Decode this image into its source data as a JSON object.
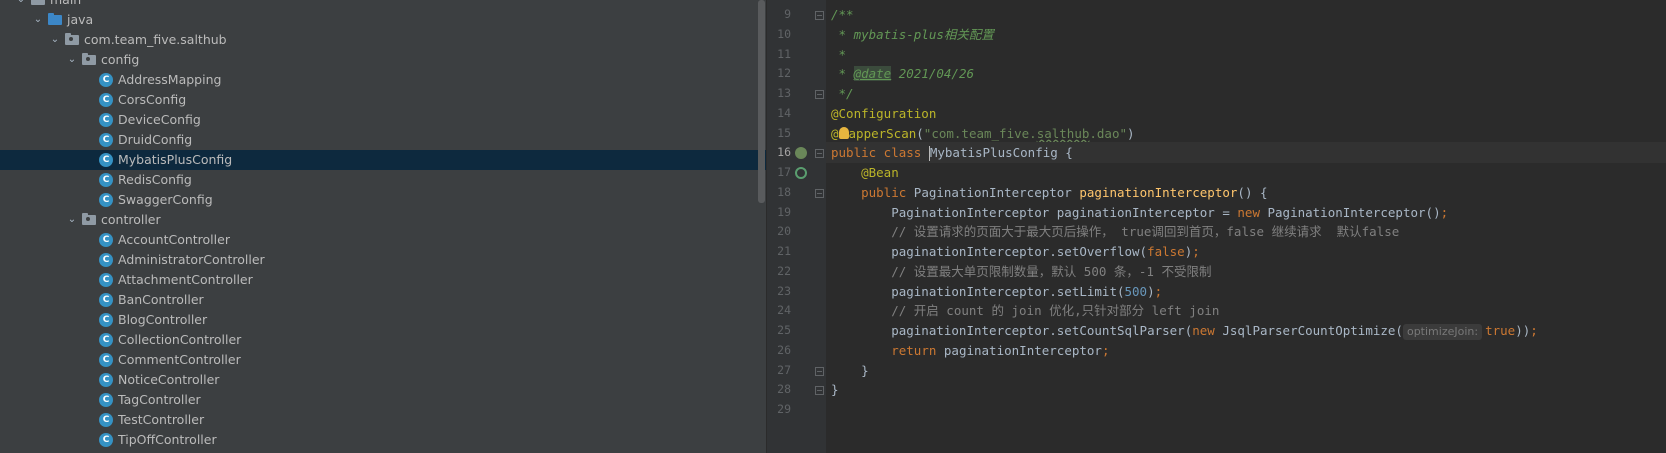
{
  "project_tree": {
    "rows": [
      {
        "label": "main",
        "indent": 1,
        "kind": "folder"
      },
      {
        "label": "java",
        "indent": 2,
        "kind": "src-folder"
      },
      {
        "label": "com.team_five.salthub",
        "indent": 3,
        "kind": "package"
      },
      {
        "label": "config",
        "indent": 4,
        "kind": "package"
      },
      {
        "label": "AddressMapping",
        "indent": 5,
        "kind": "class"
      },
      {
        "label": "CorsConfig",
        "indent": 5,
        "kind": "class"
      },
      {
        "label": "DeviceConfig",
        "indent": 5,
        "kind": "class"
      },
      {
        "label": "DruidConfig",
        "indent": 5,
        "kind": "class"
      },
      {
        "label": "MybatisPlusConfig",
        "indent": 5,
        "kind": "class",
        "selected": true
      },
      {
        "label": "RedisConfig",
        "indent": 5,
        "kind": "class"
      },
      {
        "label": "SwaggerConfig",
        "indent": 5,
        "kind": "class"
      },
      {
        "label": "controller",
        "indent": 4,
        "kind": "package"
      },
      {
        "label": "AccountController",
        "indent": 5,
        "kind": "class"
      },
      {
        "label": "AdministratorController",
        "indent": 5,
        "kind": "class"
      },
      {
        "label": "AttachmentController",
        "indent": 5,
        "kind": "class"
      },
      {
        "label": "BanController",
        "indent": 5,
        "kind": "class"
      },
      {
        "label": "BlogController",
        "indent": 5,
        "kind": "class"
      },
      {
        "label": "CollectionController",
        "indent": 5,
        "kind": "class"
      },
      {
        "label": "CommentController",
        "indent": 5,
        "kind": "class"
      },
      {
        "label": "NoticeController",
        "indent": 5,
        "kind": "class"
      },
      {
        "label": "TagController",
        "indent": 5,
        "kind": "class"
      },
      {
        "label": "TestController",
        "indent": 5,
        "kind": "class"
      },
      {
        "label": "TipOffController",
        "indent": 5,
        "kind": "class"
      }
    ]
  },
  "editor": {
    "current_line": 16,
    "lines": [
      {
        "n": 9,
        "tokens": [
          [
            "doc",
            "/**"
          ]
        ]
      },
      {
        "n": 10,
        "tokens": [
          [
            "doc",
            " * mybatis-plus相关配置"
          ]
        ]
      },
      {
        "n": 11,
        "tokens": [
          [
            "doc",
            " *"
          ]
        ]
      },
      {
        "n": 12,
        "tokens": [
          [
            "doc",
            " * "
          ],
          [
            "doctag",
            "@date"
          ],
          [
            "doc",
            " 2021/04/26"
          ]
        ]
      },
      {
        "n": 13,
        "tokens": [
          [
            "doc",
            " */"
          ]
        ]
      },
      {
        "n": 14,
        "tokens": [
          [
            "ann",
            "@Configuration"
          ]
        ]
      },
      {
        "n": 15,
        "tokens": [
          [
            "ann",
            "@"
          ],
          [
            "bulb",
            ""
          ],
          [
            "ann",
            "apperScan"
          ],
          [
            "plain",
            "("
          ],
          [
            "str",
            "\"com.team_five."
          ],
          [
            "str-ul",
            "salthub"
          ],
          [
            "str",
            ".dao\""
          ],
          [
            "plain",
            ")"
          ]
        ]
      },
      {
        "n": 16,
        "tokens": [
          [
            "kw",
            "public class "
          ],
          [
            "caret",
            ""
          ],
          [
            "plain",
            "MybatisPlusConfig {"
          ]
        ]
      },
      {
        "n": 17,
        "tokens": [
          [
            "plain",
            "    "
          ],
          [
            "ann",
            "@Bean"
          ]
        ]
      },
      {
        "n": 18,
        "tokens": [
          [
            "plain",
            "    "
          ],
          [
            "kw",
            "public "
          ],
          [
            "plain",
            "PaginationInterceptor "
          ],
          [
            "fn",
            "paginationInterceptor"
          ],
          [
            "plain",
            "() {"
          ]
        ]
      },
      {
        "n": 19,
        "tokens": [
          [
            "plain",
            "        PaginationInterceptor paginationInterceptor = "
          ],
          [
            "kw",
            "new "
          ],
          [
            "plain",
            "PaginationInterceptor()"
          ],
          [
            "kw",
            ";"
          ]
        ]
      },
      {
        "n": 20,
        "tokens": [
          [
            "cmt",
            "        // 设置请求的页面大于最大页后操作， true调回到首页，false 继续请求  默认false"
          ]
        ]
      },
      {
        "n": 21,
        "tokens": [
          [
            "plain",
            "        paginationInterceptor.setOverflow("
          ],
          [
            "kw",
            "false"
          ],
          [
            "plain",
            ")"
          ],
          [
            "kw",
            ";"
          ]
        ]
      },
      {
        "n": 22,
        "tokens": [
          [
            "cmt",
            "        // 设置最大单页限制数量，默认 500 条，-1 不受限制"
          ]
        ]
      },
      {
        "n": 23,
        "tokens": [
          [
            "plain",
            "        paginationInterceptor.setLimit("
          ],
          [
            "num",
            "500"
          ],
          [
            "plain",
            ")"
          ],
          [
            "kw",
            ";"
          ]
        ]
      },
      {
        "n": 24,
        "tokens": [
          [
            "cmt",
            "        // 开启 count 的 join 优化,只针对部分 left join"
          ]
        ]
      },
      {
        "n": 25,
        "tokens": [
          [
            "plain",
            "        paginationInterceptor.setCountSqlParser("
          ],
          [
            "kw",
            "new "
          ],
          [
            "plain",
            "JsqlParserCountOptimize("
          ],
          [
            "hint",
            "optimizeJoin:"
          ],
          [
            "kw",
            "true"
          ],
          [
            "plain",
            "))"
          ],
          [
            "kw",
            ";"
          ]
        ]
      },
      {
        "n": 26,
        "tokens": [
          [
            "plain",
            "        "
          ],
          [
            "kw",
            "return "
          ],
          [
            "plain",
            "paginationInterceptor"
          ],
          [
            "kw",
            ";"
          ]
        ]
      },
      {
        "n": 27,
        "tokens": [
          [
            "plain",
            "    }"
          ]
        ]
      },
      {
        "n": 28,
        "tokens": [
          [
            "plain",
            "}"
          ]
        ]
      },
      {
        "n": 29,
        "tokens": []
      }
    ]
  },
  "icons": {
    "class": "class-icon",
    "package": "package-folder-icon",
    "src": "source-folder-icon",
    "gutter_16": "spring-bean-icon",
    "gutter_17": "spring-bean-method-icon",
    "intention": "lightbulb-icon"
  }
}
